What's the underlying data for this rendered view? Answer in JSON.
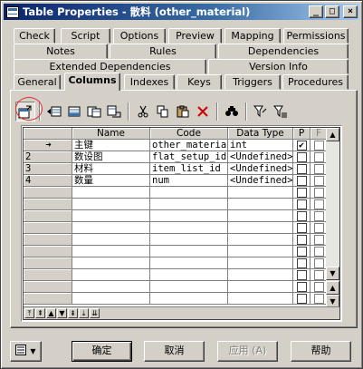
{
  "window": {
    "title": "Table Properties - 散料 (other_material)"
  },
  "tabs": {
    "row1": [
      "Check",
      "Script",
      "Options",
      "Preview",
      "Mapping",
      "Permissions"
    ],
    "row2": [
      "Notes",
      "Rules",
      "Dependencies"
    ],
    "row3": [
      "Extended Dependencies",
      "Version Info"
    ],
    "row4": [
      "General",
      "Columns",
      "Indexes",
      "Keys",
      "Triggers",
      "Procedures"
    ],
    "active": "Columns"
  },
  "grid": {
    "headers": [
      "",
      "Name",
      "Code",
      "Data Type",
      "P",
      "F"
    ],
    "rows": [
      {
        "marker": "➜",
        "name": "主键",
        "code": "other_materia",
        "type": "int",
        "p": true,
        "f": false
      },
      {
        "marker": "2",
        "name": "数设图",
        "code": "flat_setup_id",
        "type": "<Undefined>",
        "p": false,
        "f": false
      },
      {
        "marker": "3",
        "name": "材料",
        "code": "item_list_id",
        "type": "<Undefined>",
        "p": false,
        "f": false
      },
      {
        "marker": "4",
        "name": "数量",
        "code": "num",
        "type": "<Undefined>",
        "p": false,
        "f": false
      }
    ]
  },
  "buttons": {
    "ok": "确定",
    "cancel": "取消",
    "apply": "应用 (A)",
    "help": "帮助"
  },
  "colors": {
    "title_start": "#0a246a",
    "title_end": "#a6caf0",
    "face": "#d4d0c8",
    "highlight_circle": "#e03030"
  }
}
